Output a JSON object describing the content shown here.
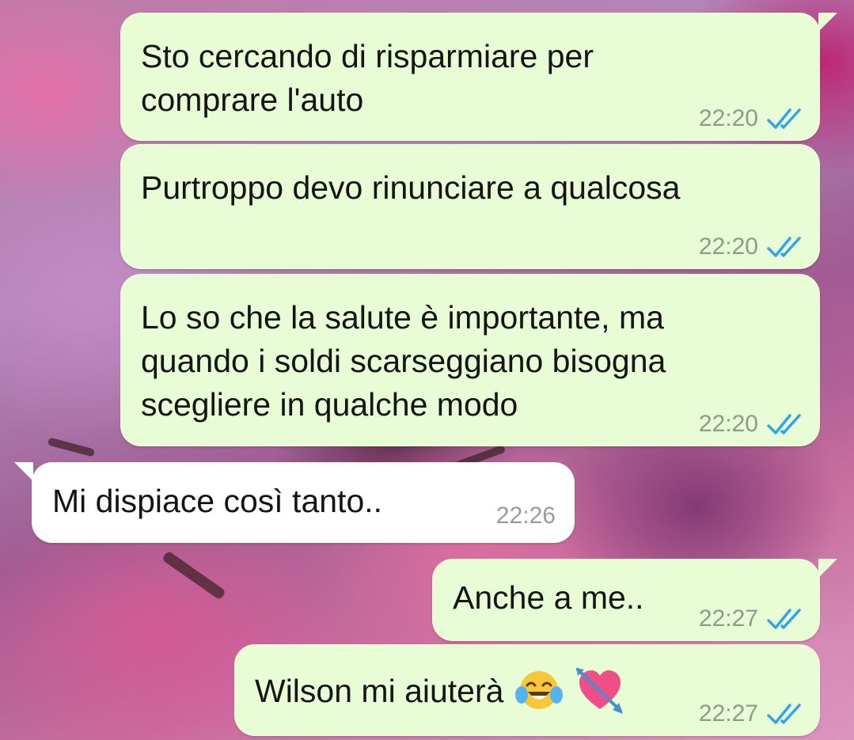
{
  "wallpaper": "pink-magnolia-blossom-photo",
  "colors": {
    "outgoing_bubble": "#e8fcd6",
    "incoming_bubble": "#ffffff",
    "read_ticks": "#34a3e8",
    "timestamp": "#8e9a8a"
  },
  "messages": [
    {
      "direction": "outgoing",
      "text": "Sto cercando di risparmiare per\ncomprare l'auto",
      "time": "22:20",
      "status": "read"
    },
    {
      "direction": "outgoing",
      "text": "Purtroppo devo rinunciare a qualcosa",
      "time": "22:20",
      "status": "read"
    },
    {
      "direction": "outgoing",
      "text": "Lo so che la salute è importante, ma\nquando i soldi scarseggiano bisogna\nscegliere in qualche modo",
      "time": "22:20",
      "status": "read"
    },
    {
      "direction": "incoming",
      "text": "Mi dispiace così tanto..",
      "time": "22:26"
    },
    {
      "direction": "outgoing",
      "text": "Anche a me..",
      "time": "22:27",
      "status": "read"
    },
    {
      "direction": "outgoing",
      "text": "Wilson mi aiuterà",
      "emojis": [
        "face-with-tears-of-joy",
        "heart-with-arrow"
      ],
      "time": "22:27",
      "status": "read"
    }
  ]
}
